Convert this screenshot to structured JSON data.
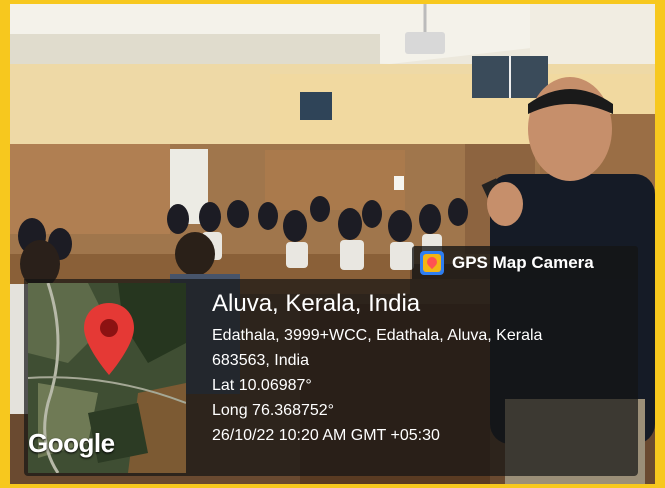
{
  "stamp": {
    "app_name": "GPS Map Camera",
    "app_icon": "gps-map-camera-icon",
    "map_brand": "Google",
    "location_title": "Aluva, Kerala, India",
    "address_line1": "Edathala, 3999+WCC, Edathala, Aluva, Kerala",
    "address_line2": "683563, India",
    "latitude": "Lat 10.06987°",
    "longitude": "Long 76.368752°",
    "datetime": "26/10/22 10:20 AM GMT +05:30"
  },
  "colors": {
    "frame": "#f7c81e",
    "overlay": "rgba(20,20,20,0.70)",
    "map_pin": "#e53935"
  }
}
